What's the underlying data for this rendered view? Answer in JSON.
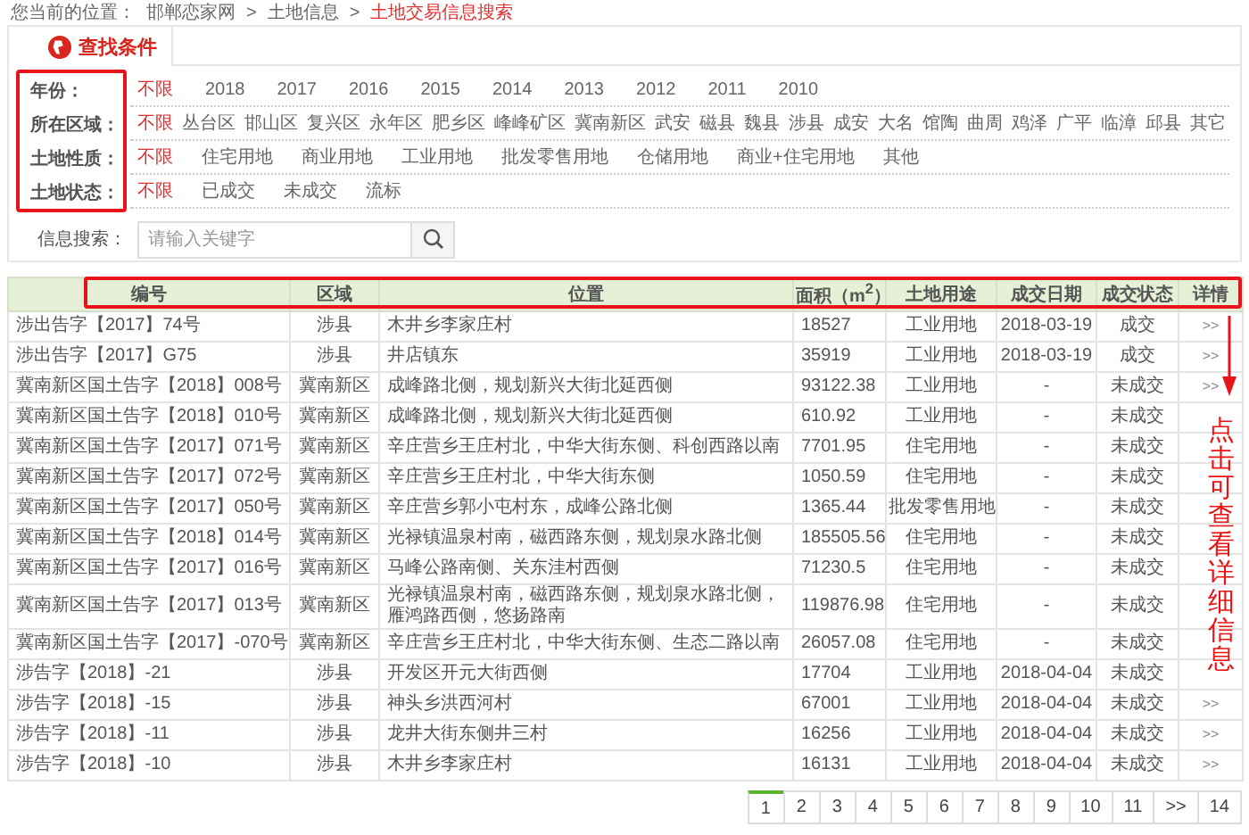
{
  "breadcrumb": {
    "label": "您当前的位置：",
    "items": [
      {
        "text": "邯郸恋家网",
        "current": false
      },
      {
        "text": "土地信息",
        "current": false
      },
      {
        "text": "土地交易信息搜索",
        "current": true
      }
    ],
    "separator": ">"
  },
  "tab": {
    "label": "查找条件"
  },
  "filters": [
    {
      "label": "年份：",
      "options": [
        {
          "text": "不限",
          "selected": true
        },
        {
          "text": "2018",
          "selected": false
        },
        {
          "text": "2017",
          "selected": false
        },
        {
          "text": "2016",
          "selected": false
        },
        {
          "text": "2015",
          "selected": false
        },
        {
          "text": "2014",
          "selected": false
        },
        {
          "text": "2013",
          "selected": false
        },
        {
          "text": "2012",
          "selected": false
        },
        {
          "text": "2011",
          "selected": false
        },
        {
          "text": "2010",
          "selected": false
        }
      ]
    },
    {
      "label": "所在区域：",
      "options": [
        {
          "text": "不限",
          "selected": true
        },
        {
          "text": "丛台区",
          "selected": false
        },
        {
          "text": "邯山区",
          "selected": false
        },
        {
          "text": "复兴区",
          "selected": false
        },
        {
          "text": "永年区",
          "selected": false
        },
        {
          "text": "肥乡区",
          "selected": false
        },
        {
          "text": "峰峰矿区",
          "selected": false
        },
        {
          "text": "冀南新区",
          "selected": false
        },
        {
          "text": "武安",
          "selected": false
        },
        {
          "text": "磁县",
          "selected": false
        },
        {
          "text": "魏县",
          "selected": false
        },
        {
          "text": "涉县",
          "selected": false
        },
        {
          "text": "成安",
          "selected": false
        },
        {
          "text": "大名",
          "selected": false
        },
        {
          "text": "馆陶",
          "selected": false
        },
        {
          "text": "曲周",
          "selected": false
        },
        {
          "text": "鸡泽",
          "selected": false
        },
        {
          "text": "广平",
          "selected": false
        },
        {
          "text": "临漳",
          "selected": false
        },
        {
          "text": "邱县",
          "selected": false
        },
        {
          "text": "其它",
          "selected": false
        }
      ]
    },
    {
      "label": "土地性质：",
      "options": [
        {
          "text": "不限",
          "selected": true
        },
        {
          "text": "住宅用地",
          "selected": false
        },
        {
          "text": "商业用地",
          "selected": false
        },
        {
          "text": "工业用地",
          "selected": false
        },
        {
          "text": "批发零售用地",
          "selected": false
        },
        {
          "text": "仓储用地",
          "selected": false
        },
        {
          "text": "商业+住宅用地",
          "selected": false
        },
        {
          "text": "其他",
          "selected": false
        }
      ]
    },
    {
      "label": "土地状态：",
      "options": [
        {
          "text": "不限",
          "selected": true
        },
        {
          "text": "已成交",
          "selected": false
        },
        {
          "text": "未成交",
          "selected": false
        },
        {
          "text": "流标",
          "selected": false
        }
      ]
    }
  ],
  "search": {
    "label": "信息搜索：",
    "placeholder": "请输入关键字"
  },
  "table": {
    "columns": [
      "编号",
      "区域",
      "位置",
      "面积（m$^{2}$）",
      "土地用途",
      "成交日期",
      "成交状态",
      "详情"
    ],
    "rows": [
      {
        "cells": [
          "涉出告字【2017】74号",
          "涉县",
          "木井乡李家庄村",
          "18527",
          "工业用地",
          "2018-03-19",
          "成交"
        ],
        "detail": ">>"
      },
      {
        "cells": [
          "涉出告字【2017】G75",
          "涉县",
          "井店镇东",
          "35919",
          "工业用地",
          "2018-03-19",
          "成交"
        ],
        "detail": ">>"
      },
      {
        "cells": [
          "冀南新区国土告字【2018】008号",
          "冀南新区",
          "成峰路北侧，规划新兴大街北延西侧",
          "93122.38",
          "工业用地",
          "-",
          "未成交"
        ],
        "detail": ">>"
      },
      {
        "cells": [
          "冀南新区国土告字【2018】010号",
          "冀南新区",
          "成峰路北侧，规划新兴大街北延西侧",
          "610.92",
          "工业用地",
          "-",
          "未成交"
        ]
      },
      {
        "cells": [
          "冀南新区国土告字【2017】071号",
          "冀南新区",
          "辛庄营乡王庄村北，中华大街东侧、科创西路以南",
          "7701.95",
          "住宅用地",
          "-",
          "未成交"
        ]
      },
      {
        "cells": [
          "冀南新区国土告字【2017】072号",
          "冀南新区",
          "辛庄营乡王庄村北，中华大街东侧",
          "1050.59",
          "住宅用地",
          "-",
          "未成交"
        ]
      },
      {
        "cells": [
          "冀南新区国土告字【2017】050号",
          "冀南新区",
          "辛庄营乡郭小屯村东，成峰公路北侧",
          "1365.44",
          "批发零售用地",
          "-",
          "未成交"
        ]
      },
      {
        "cells": [
          "冀南新区国土告字【2018】014号",
          "冀南新区",
          "光禄镇温泉村南，磁西路东侧，规划泉水路北侧",
          "185505.56",
          "住宅用地",
          "-",
          "未成交"
        ]
      },
      {
        "cells": [
          "冀南新区国土告字【2017】016号",
          "冀南新区",
          "马峰公路南侧、关东洼村西侧",
          "71230.5",
          "住宅用地",
          "-",
          "未成交"
        ]
      },
      {
        "cells": [
          "冀南新区国土告字【2017】013号",
          "冀南新区",
          "光禄镇温泉村南，磁西路东侧，规划泉水路北侧，雁鸿路西侧，悠扬路南",
          "119876.98",
          "住宅用地",
          "-",
          "未成交"
        ]
      },
      {
        "cells": [
          "冀南新区国土告字【2017】-070号",
          "冀南新区",
          "辛庄营乡王庄村北，中华大街东侧、生态二路以南",
          "26057.08",
          "住宅用地",
          "-",
          "未成交"
        ]
      },
      {
        "cells": [
          "涉告字【2018】-21",
          "涉县",
          "开发区开元大街西侧",
          "17704",
          "工业用地",
          "2018-04-04",
          "未成交"
        ]
      },
      {
        "cells": [
          "涉告字【2018】-15",
          "涉县",
          "神头乡洪西河村",
          "67001",
          "工业用地",
          "2018-04-04",
          "未成交"
        ],
        "detail": ">>"
      },
      {
        "cells": [
          "涉告字【2018】-11",
          "涉县",
          "龙井大街东侧井三村",
          "16256",
          "工业用地",
          "2018-04-04",
          "未成交"
        ],
        "detail": ">>"
      },
      {
        "cells": [
          "涉告字【2018】-10",
          "涉县",
          "木井乡李家庄村",
          "16131",
          "工业用地",
          "2018-04-04",
          "未成交"
        ],
        "detail": ">>"
      }
    ]
  },
  "annotation": {
    "note": "点击可查看详细信息"
  },
  "pagination": [
    {
      "label": "1",
      "selected": true
    },
    {
      "label": "2",
      "selected": false
    },
    {
      "label": "3",
      "selected": false
    },
    {
      "label": "4",
      "selected": false
    },
    {
      "label": "5",
      "selected": false
    },
    {
      "label": "6",
      "selected": false
    },
    {
      "label": "7",
      "selected": false
    },
    {
      "label": "8",
      "selected": false
    },
    {
      "label": "9",
      "selected": false
    },
    {
      "label": "10",
      "selected": false
    },
    {
      "label": "11",
      "selected": false
    },
    {
      "label": ">>",
      "selected": false
    },
    {
      "label": "14",
      "selected": false
    }
  ]
}
